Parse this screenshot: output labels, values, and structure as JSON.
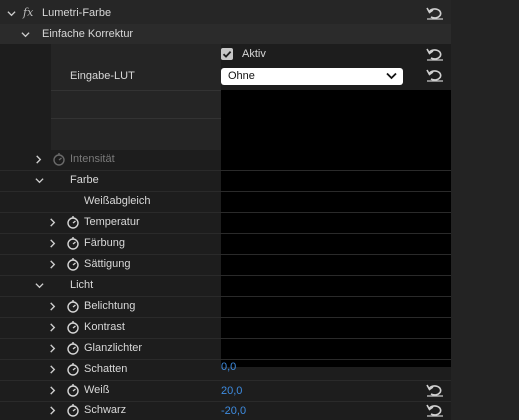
{
  "effect": {
    "fx_label": "fx",
    "name": "Lumetri-Farbe"
  },
  "basic": {
    "title": "Einfache Korrektur",
    "active_label": "Aktiv",
    "active_checked": true,
    "lut_label": "Eingabe-LUT",
    "lut_value": "Ohne"
  },
  "params": {
    "intensity": "Intensität",
    "color_section": "Farbe",
    "white_balance": "Weißabgleich",
    "temperature": "Temperatur",
    "tint": "Färbung",
    "saturation": "Sättigung",
    "light_section": "Licht",
    "exposure": "Belichtung",
    "contrast": "Kontrast",
    "highlights": "Glanzlichter",
    "shadows": "Schatten",
    "shadows_value": "0,0",
    "whites": "Weiß",
    "whites_value": "20,0",
    "blacks": "Schwarz",
    "blacks_value": "-20,0"
  },
  "colors": {
    "value_blue": "#3e8ce0",
    "panel_bg": "#1d1d1d"
  }
}
